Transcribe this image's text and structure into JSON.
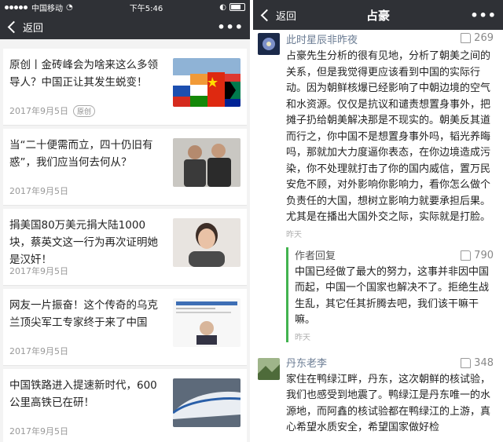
{
  "status": {
    "carrier": "中国移动",
    "time": "下午5:46"
  },
  "left_nav": {
    "back": "返回",
    "more": "•••"
  },
  "articles": [
    {
      "title": "原创丨金砖峰会为啥来这么多领导人？中国正让其发生蜕变！",
      "date": "2017年9月5日",
      "tag": "原创"
    },
    {
      "title": "当“二十便需而立，四十仍旧有惑”，我们应当何去何从？",
      "date": "2017年9月5日"
    },
    {
      "title": "捐美国80万美元捐大陆1000块，蔡英文这一行为再次证明她是汉奸！",
      "date": "2017年9月5日"
    },
    {
      "title": "网友一片振奋！这个传奇的乌克兰顶尖军工专家终于来了中国",
      "date": "2017年9月5日"
    },
    {
      "title": "中国铁路进入提速新时代，600公里高铁已在研！",
      "date": "2017年9月5日"
    }
  ],
  "right_nav": {
    "back": "返回",
    "title": "占豪",
    "more": "•••"
  },
  "comments": [
    {
      "name": "此时星辰非昨夜",
      "likes": "269",
      "text": "占豪先生分析的很有见地，分析了朝美之间的关系，但是我觉得更应该看到中国的实际行动。因为朝鲜核爆已经影响了中朝边境的空气和水资源。仅仅是抗议和谴责想置身事外，把摊子扔给朝美解决那是不现实的。朝美反其道而行之，你中国不是想置身事外吗，韬光养晦吗，那就加大力度逼你表态，在你边境造成污染，你不处理就打击了你的国内威信，置万民安危不顾，对外影响你影响力，看你怎么做个负责任的大国，想树立影响力就要承担后果。尤其是在播出大国外交之际，实际就是打脸。",
      "time": "昨天"
    },
    {
      "reply": true,
      "name": "作者回复",
      "likes": "790",
      "text": "中国已经做了最大的努力，这事并非因中国而起，中国一个国家也解决不了。拒绝生战生乱，其它任其折腾去吧，我们该干嘛干嘛。",
      "time": "昨天"
    },
    {
      "name": "丹东老李",
      "likes": "348",
      "text": "家住在鸭绿江畔，丹东，这次朝鲜的核试验，我们也感受到地震了。鸭绿江是丹东唯一的水源地，而阿鑫的核试验都在鸭绿江的上游，真心希望水质安全，希望国家做好检",
      "time": ""
    }
  ],
  "colors": {
    "header": "#2f3136",
    "link": "#6b7c93",
    "reply_bar": "#42b34f"
  }
}
